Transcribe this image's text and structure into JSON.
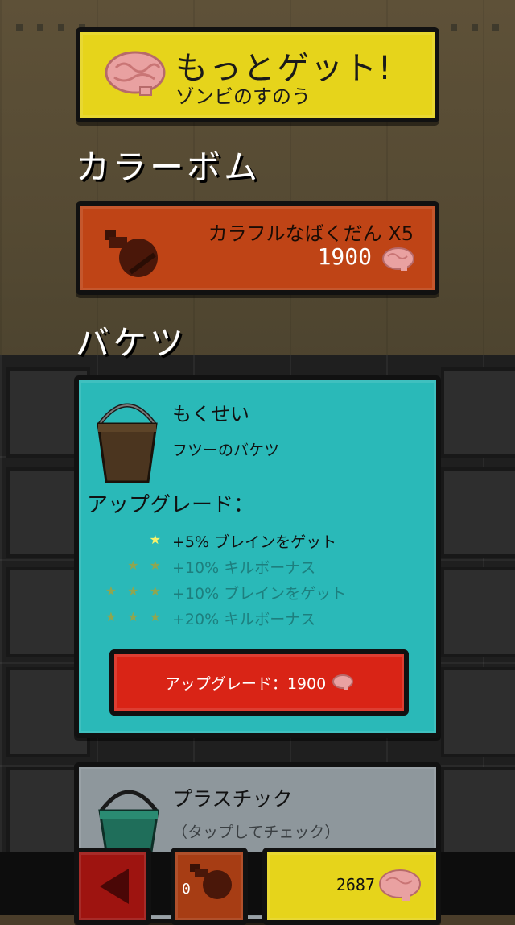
{
  "get_more": {
    "title": "もっとゲット!",
    "subtitle": "ゾンビのすのう"
  },
  "sections": {
    "color_bomb": "カラーボム",
    "bucket": "バケツ"
  },
  "bomb_item": {
    "name": "カラフルなばくだん X5",
    "price": "1900"
  },
  "bucket_selected": {
    "name": "もくせい",
    "description": "フツーのバケツ",
    "upgrades_title": "アップグレード：",
    "upgrades": [
      {
        "stars": "★",
        "text": "+5% ブレインをゲット",
        "active": true
      },
      {
        "stars": "★ ★",
        "text": "+10% キルボーナス",
        "active": false
      },
      {
        "stars": "★ ★ ★",
        "text": "+10% ブレインをゲット",
        "active": false
      },
      {
        "stars": "★ ★ ★",
        "text": "+20% キルボーナス",
        "active": false
      }
    ],
    "upgrade_button": "アップグレード：1900"
  },
  "bucket_next": {
    "name": "プラスチック",
    "hint": "（タップしてチェック）"
  },
  "bottom": {
    "bomb_count": "0",
    "brain_count": "2687"
  },
  "colors": {
    "yellow": "#e6d41b",
    "orange": "#bf4416",
    "teal": "#2ab9b8",
    "red": "#d92416",
    "gray": "#8e979c"
  }
}
